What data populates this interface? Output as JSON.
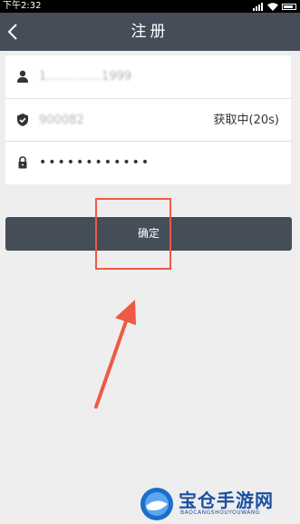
{
  "status_bar": {
    "time": "下午2:32"
  },
  "nav": {
    "title": "注册"
  },
  "form": {
    "phone_value": "1‥‥‥‥‥‥‥1999",
    "code_value": "900082",
    "code_button": "获取中(20s)",
    "password_value": "••••••••••••"
  },
  "actions": {
    "confirm_label": "确定"
  },
  "watermark": {
    "cn": "宝仓手游网",
    "en": "BAOCANGSHOUYOUWANG"
  },
  "colors": {
    "nav_bg": "#454d58",
    "page_bg": "#eeeeee",
    "annotation": "#ef5a44",
    "watermark": "#1b4fa3"
  }
}
